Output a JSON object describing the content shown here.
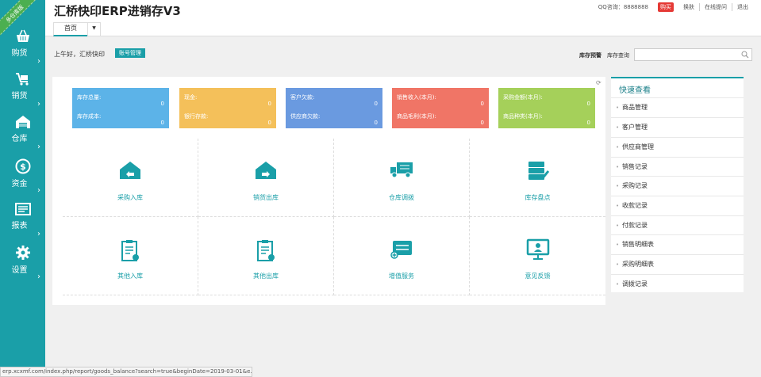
{
  "ribbon": "多仓库版",
  "sidebar": {
    "items": [
      {
        "label": "购货",
        "icon": "basket-icon"
      },
      {
        "label": "销货",
        "icon": "cart-icon"
      },
      {
        "label": "仓库",
        "icon": "warehouse-icon"
      },
      {
        "label": "资金",
        "icon": "dollar-icon"
      },
      {
        "label": "报表",
        "icon": "report-icon"
      },
      {
        "label": "设置",
        "icon": "gear-icon"
      }
    ]
  },
  "header": {
    "title": "汇桥快印ERP进销存V3",
    "qq": "QQ咨询：8888888",
    "buy": "购买",
    "skin": "换肤",
    "online_help": "在线提问",
    "logout": "退出",
    "tab_home": "首页"
  },
  "subheader": {
    "greeting": "上午好，汇桥快印",
    "account_btn": "账号管理",
    "inv_alert": "库存预警",
    "inv_query": "库存查询",
    "search_placeholder": ""
  },
  "stats": [
    {
      "label1": "库存总量:",
      "value1": "0",
      "label2": "库存成本:",
      "value2": "0",
      "color": "#5cb3e8"
    },
    {
      "label1": "现金:",
      "value1": "0",
      "label2": "银行存款:",
      "value2": "0",
      "color": "#f4c05a"
    },
    {
      "label1": "客户欠款:",
      "value1": "0",
      "label2": "供应商欠款:",
      "value2": "0",
      "color": "#6a9ae0"
    },
    {
      "label1": "销售收入(本月):",
      "value1": "0",
      "label2": "商品毛利(本月):",
      "value2": "0",
      "color": "#f07566"
    },
    {
      "label1": "采购金额(本月):",
      "value1": "0",
      "label2": "商品种类(本月):",
      "value2": "0",
      "color": "#a5d05a"
    }
  ],
  "grid": [
    {
      "label": "采购入库",
      "icon": "purchase-in-icon"
    },
    {
      "label": "销货出库",
      "icon": "sales-out-icon"
    },
    {
      "label": "仓库调拨",
      "icon": "truck-icon"
    },
    {
      "label": "库存盘点",
      "icon": "inventory-check-icon"
    },
    {
      "label": "其他入库",
      "icon": "other-in-icon"
    },
    {
      "label": "其他出库",
      "icon": "other-out-icon"
    },
    {
      "label": "增值服务",
      "icon": "value-service-icon"
    },
    {
      "label": "意见反馈",
      "icon": "feedback-icon"
    }
  ],
  "quick": {
    "title": "快速查看",
    "items": [
      "商品管理",
      "客户管理",
      "供应商管理",
      "销售记录",
      "采购记录",
      "收款记录",
      "付款记录",
      "销售明细表",
      "采购明细表",
      "调拨记录"
    ]
  },
  "status_url": "erp.xcxmf.com/index.php/report/goods_balance?search=true&beginDate=2019-03-01&e...",
  "colors": {
    "accent": "#1a9fa8",
    "buy": "#e53935"
  }
}
